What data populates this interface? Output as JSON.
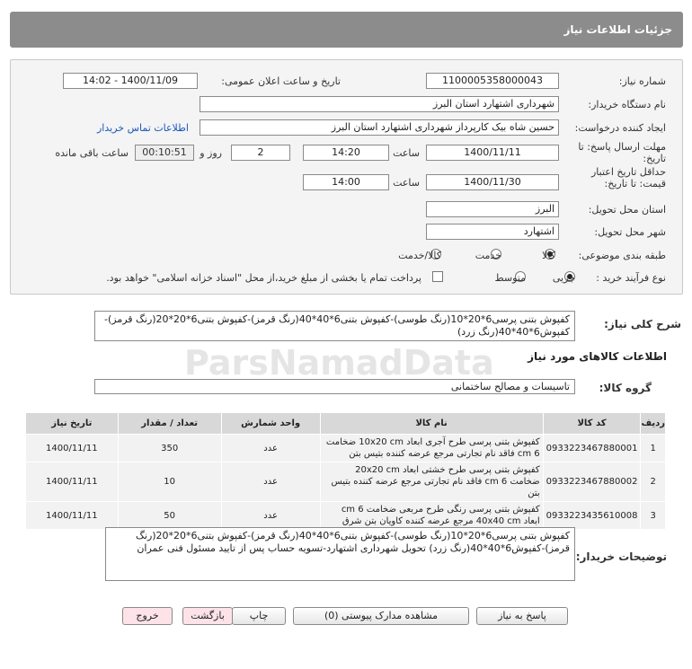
{
  "header": {
    "title": "جزئیات اطلاعات نیاز"
  },
  "form": {
    "need_number_label": "شماره نیاز:",
    "need_number": "1100005358000043",
    "announce_label": "تاریخ و ساعت اعلان عمومی:",
    "announce_value": "1400/11/09 - 14:02",
    "buyer_org_label": "نام دستگاه خریدار:",
    "buyer_org": "شهرداری اشتهارد استان البرز",
    "creator_label": "ایجاد کننده درخواست:",
    "creator": "حسین شاه بیک کارپرداز شهرداری اشتهارد استان البرز",
    "contact_link": "اطلاعات تماس خریدار",
    "deadline_label": "مهلت ارسال پاسخ: تا تاریخ:",
    "deadline_date": "1400/11/11",
    "time_label": "ساعت",
    "deadline_time": "14:20",
    "days_value": "2",
    "days_label": "روز و",
    "remaining_time": "00:10:51",
    "remaining_label": "ساعت باقی مانده",
    "validity_label": "حداقل تاریخ اعتبار قیمت: تا تاریخ:",
    "validity_date": "1400/11/30",
    "validity_time_label": "ساعت",
    "validity_time": "14:00",
    "province_label": "استان محل تحویل:",
    "province": "البرز",
    "city_label": "شهر محل تحویل:",
    "city": "اشتهارد",
    "category_label": "طبقه بندی موضوعی:",
    "category_options": [
      "کالا",
      "خدمت",
      "کالا/خدمت"
    ],
    "category_selected": "کالا",
    "purchase_label": "نوع فرآیند خرید :",
    "purchase_options": [
      "جزیی",
      "متوسط"
    ],
    "purchase_selected": "جزیی",
    "payment_note": "پرداخت تمام یا بخشی از مبلغ خرید،از محل \"اسناد خزانه اسلامی\" خواهد بود."
  },
  "summary": {
    "label": "شرح کلی نیاز:",
    "text": "کفپوش بتنی پرسی6*20*10(رنگ طوسی)-کفپوش بتنی6*40*40(رنگ قرمز)-کفپوش بتنی6*20*20(رنگ قرمز)-کفپوش6*40*40(رنگ زرد)"
  },
  "goods": {
    "section_title": "اطلاعات کالاهای مورد نیاز",
    "group_label": "گروه کالا:",
    "group_value": "تاسیسات و مصالح ساختمانی",
    "columns": [
      "ردیف",
      "کد کالا",
      "نام کالا",
      "واحد شمارش",
      "تعداد / مقدار",
      "تاریخ نیاز"
    ],
    "rows": [
      {
        "idx": "1",
        "code": "0933223467880001",
        "name": "کفپوش بتنی پرسی طرح آجری ابعاد 10x20 cm ضخامت 6 cm فاقد نام تجارتی مرجع عرضه کننده بتیس بتن",
        "unit": "عدد",
        "qty": "350",
        "date": "1400/11/11"
      },
      {
        "idx": "2",
        "code": "0933223467880002",
        "name": "کفپوش بتنی پرسی طرح خشتی ابعاد 20x20 cm ضخامت 6 cm فاقد نام تجارتی مرجع عرضه کننده بتیس بتن",
        "unit": "عدد",
        "qty": "10",
        "date": "1400/11/11"
      },
      {
        "idx": "3",
        "code": "0933223435610008",
        "name": "کفپوش بتنی پرسی رنگی طرح مربعی ضخامت 6 cm ابعاد 40x40 cm مرجع عرضه کننده کاویان بتن شرق",
        "unit": "عدد",
        "qty": "50",
        "date": "1400/11/11"
      }
    ]
  },
  "buyer_notes": {
    "label": "توضیحات خریدار:",
    "text": "کفپوش بتنی پرسی6*20*10(رنگ طوسی)-کفپوش بتنی6*40*40(رنگ قرمز)-کفپوش بتنی6*20*20(رنگ قرمز)-کفپوش6*40*40(رنگ زرد) تحویل شهرداری اشتهارد-تسویه حساب پس از تایید مسئول فنی عمران"
  },
  "buttons": {
    "reply": "پاسخ به نیاز",
    "attachments": "مشاهده مدارک پیوستی (0)",
    "print": "چاپ",
    "back": "بازگشت",
    "exit": "خروج"
  },
  "watermark": {
    "brand": "ParsNamadData"
  },
  "colors": {
    "header_bg": "#8c8c8c",
    "panel_bg": "#f4f4f4",
    "link": "#1a56b8",
    "pink_button": "#fde3e8"
  }
}
